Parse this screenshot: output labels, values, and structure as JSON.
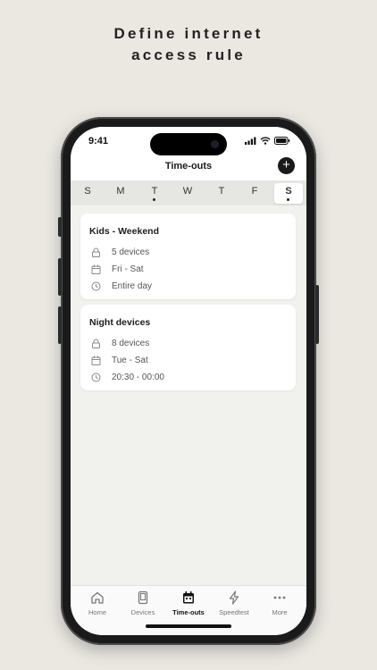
{
  "headline": {
    "line1": "Define internet",
    "line2": "access rule"
  },
  "status": {
    "time": "9:41"
  },
  "nav": {
    "title": "Time-outs",
    "add_label": "+"
  },
  "week": {
    "days": [
      {
        "label": "S",
        "dot": false,
        "selected": false
      },
      {
        "label": "M",
        "dot": false,
        "selected": false
      },
      {
        "label": "T",
        "dot": true,
        "selected": false
      },
      {
        "label": "W",
        "dot": false,
        "selected": false
      },
      {
        "label": "T",
        "dot": false,
        "selected": false
      },
      {
        "label": "F",
        "dot": false,
        "selected": false
      },
      {
        "label": "S",
        "dot": true,
        "selected": true
      }
    ]
  },
  "rules": [
    {
      "title": "Kids - Weekend",
      "devices": "5 devices",
      "days": "Fri - Sat",
      "time": "Entire day"
    },
    {
      "title": "Night devices",
      "devices": "8 devices",
      "days": "Tue - Sat",
      "time": "20:30 - 00:00"
    }
  ],
  "tabs": [
    {
      "label": "Home",
      "icon": "home-icon",
      "active": false
    },
    {
      "label": "Devices",
      "icon": "devices-icon",
      "active": false
    },
    {
      "label": "Time-outs",
      "icon": "calendar-icon",
      "active": true
    },
    {
      "label": "Speedtest",
      "icon": "lightning-icon",
      "active": false
    },
    {
      "label": "More",
      "icon": "more-icon",
      "active": false
    }
  ],
  "colors": {
    "background": "#ebe8e2",
    "screen": "#f1f1ee",
    "accent": "#1a1a1a"
  }
}
